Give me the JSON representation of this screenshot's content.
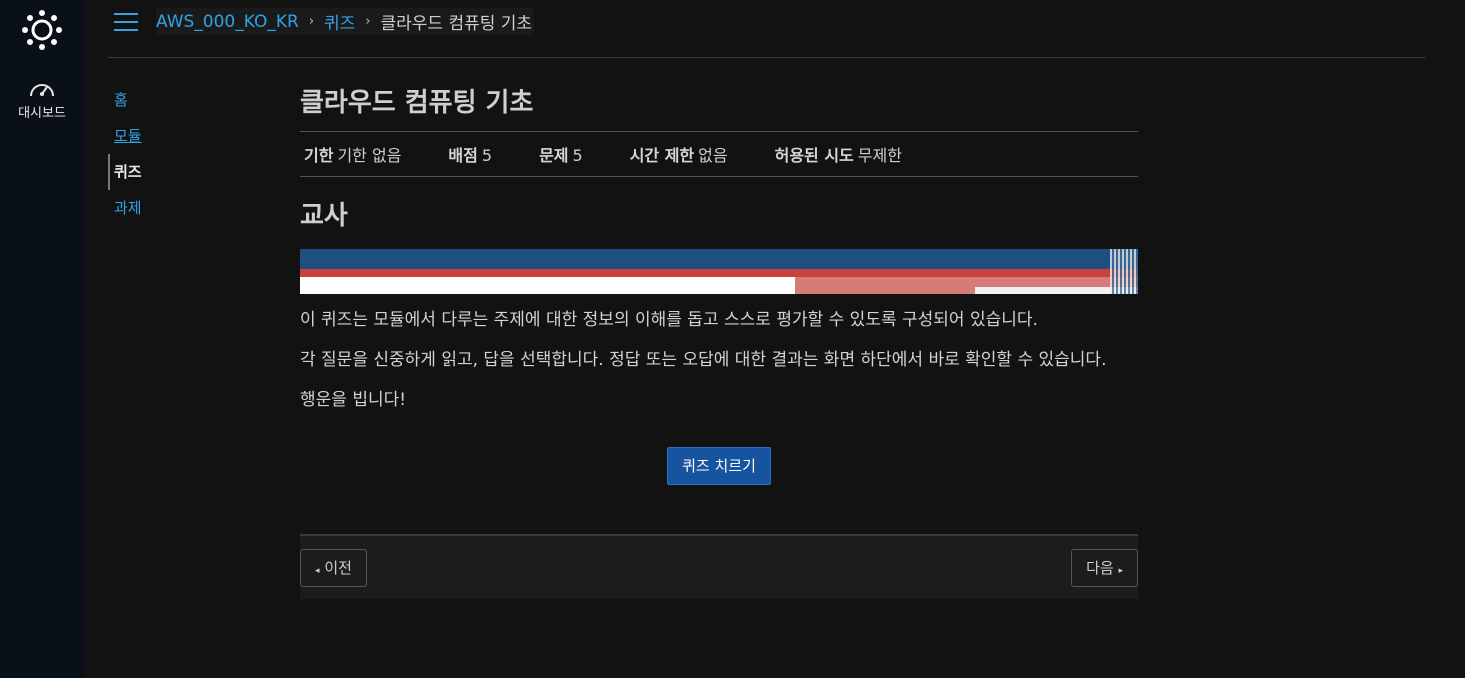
{
  "global_nav": {
    "dashboard_label": "대시보드"
  },
  "breadcrumb": {
    "course": "AWS_000_KO_KR",
    "section": "퀴즈",
    "current": "클라우드 컴퓨팅 기초"
  },
  "course_nav": {
    "home": "홈",
    "modules": "모듈",
    "quizzes": "퀴즈",
    "assignments": "과제"
  },
  "quiz": {
    "title": "클라우드 컴퓨팅 기초",
    "meta": [
      {
        "label": "기한",
        "value": "기한 없음"
      },
      {
        "label": "배점",
        "value": "5"
      },
      {
        "label": "문제",
        "value": "5"
      },
      {
        "label": "시간 제한",
        "value": "없음"
      },
      {
        "label": "허용된 시도",
        "value": "무제한"
      }
    ],
    "section_heading": "교사",
    "paragraphs": [
      "이 퀴즈는 모듈에서 다루는 주제에 대한 정보의 이해를 돕고 스스로 평가할 수 있도록 구성되어 있습니다.",
      "각 질문을 신중하게 읽고, 답을 선택합니다. 정답 또는 오답에 대한 결과는 화면 하단에서 바로 확인할 수 있습니다.",
      "행운을 빕니다!"
    ],
    "take_button": "퀴즈 치르기"
  },
  "footer": {
    "prev_label": "이전",
    "next_label": "다음",
    "prev_icon": "◂",
    "next_icon": "▸"
  },
  "colors": {
    "link": "#2ea3e6",
    "primary_button": "#1654a0",
    "background": "#121212",
    "global_nav": "#0a1017"
  }
}
